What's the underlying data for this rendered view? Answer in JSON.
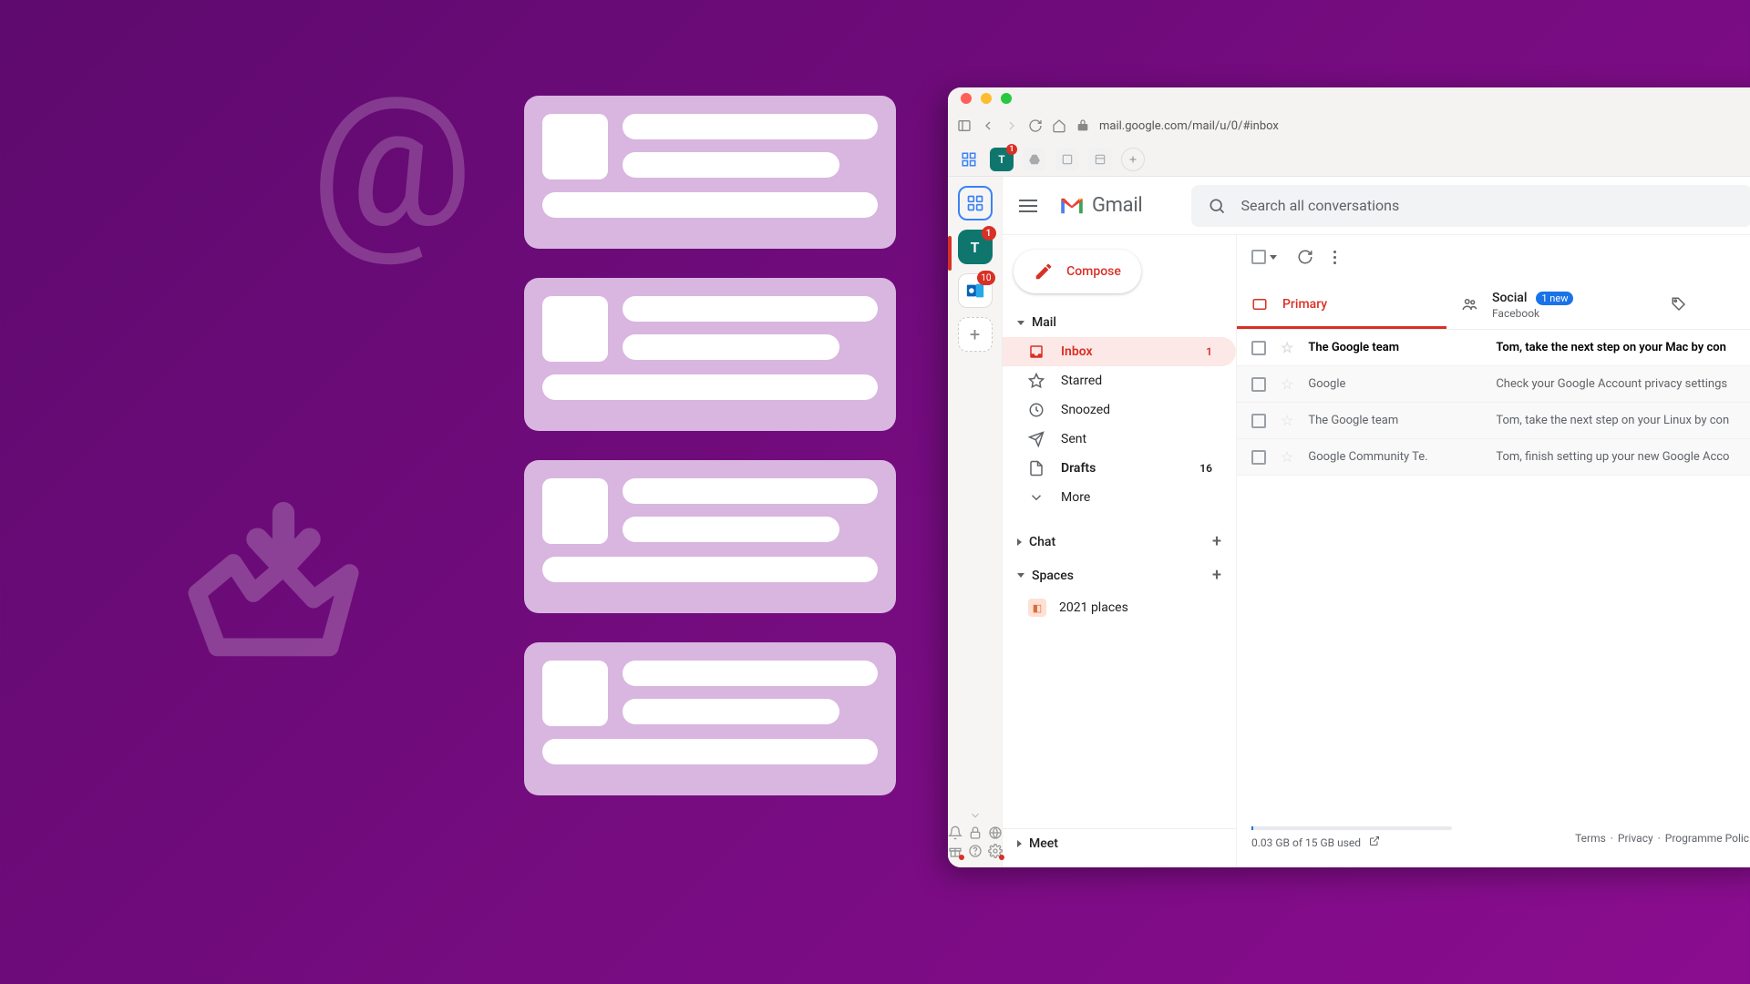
{
  "browser": {
    "url": "mail.google.com/mail/u/0/#inbox",
    "tabs": {
      "account_badge": "1"
    }
  },
  "rail": {
    "account_initial": "T",
    "teal_badge": "1",
    "outlook_badge": "10"
  },
  "gmail": {
    "brand": "Gmail",
    "search_placeholder": "Search all conversations",
    "compose": "Compose",
    "sections": {
      "mail": "Mail",
      "chat": "Chat",
      "spaces": "Spaces",
      "meet": "Meet"
    },
    "nav": {
      "inbox": {
        "label": "Inbox",
        "count": "1"
      },
      "starred": "Starred",
      "snoozed": "Snoozed",
      "sent": "Sent",
      "drafts": {
        "label": "Drafts",
        "count": "16"
      },
      "more": "More"
    },
    "spaces_item": "2021 places",
    "tabs": {
      "primary": "Primary",
      "social": {
        "label": "Social",
        "pill": "1 new",
        "sub": "Facebook"
      }
    },
    "mails": [
      {
        "sender": "The Google team",
        "subject": "Tom, take the next step on your Mac by con",
        "unread": true
      },
      {
        "sender": "Google",
        "subject": "Check your Google Account privacy settings",
        "unread": false
      },
      {
        "sender": "The Google team",
        "subject": "Tom, take the next step on your Linux by con",
        "unread": false
      },
      {
        "sender": "Google Community Te.",
        "subject": "Tom, finish setting up your new Google Acco",
        "unread": false
      }
    ],
    "footer": {
      "storage": "0.03 GB of 15 GB used",
      "terms": "Terms",
      "privacy": "Privacy",
      "program": "Programme Polici"
    }
  }
}
